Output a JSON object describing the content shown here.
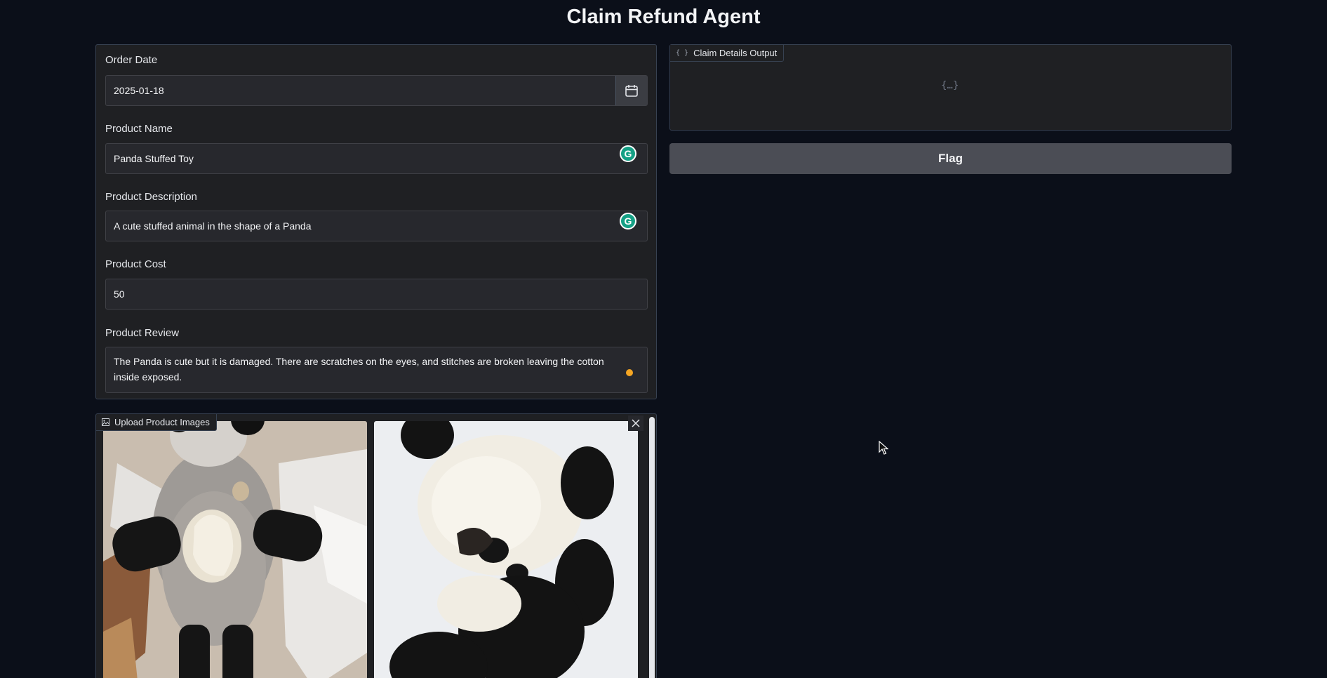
{
  "app": {
    "title": "Claim Refund Agent"
  },
  "form": {
    "order_date": {
      "label": "Order Date",
      "value": "2025-01-18"
    },
    "product_name": {
      "label": "Product Name",
      "value": "Panda Stuffed Toy"
    },
    "product_description": {
      "label": "Product Description",
      "value": "A cute stuffed animal in the shape of a Panda"
    },
    "product_cost": {
      "label": "Product Cost",
      "value": "50"
    },
    "product_review": {
      "label": "Product Review",
      "value": "The Panda is cute but it is damaged. There are scratches on the eyes, and stitches are broken leaving the cotton inside exposed."
    }
  },
  "upload": {
    "label": "Upload Product Images",
    "images": [
      {
        "subject": "damaged-panda-toy-front"
      },
      {
        "subject": "damaged-panda-toy-side"
      }
    ]
  },
  "output": {
    "label": "Claim Details Output",
    "empty_placeholder": "{…}"
  },
  "actions": {
    "flag_label": "Flag"
  },
  "colors": {
    "background": "#0b0f19",
    "panel": "#1f2023",
    "input": "#27282d",
    "button": "#4b4d55",
    "grammarly": "#15a085",
    "status_dot": "#f5a623"
  }
}
